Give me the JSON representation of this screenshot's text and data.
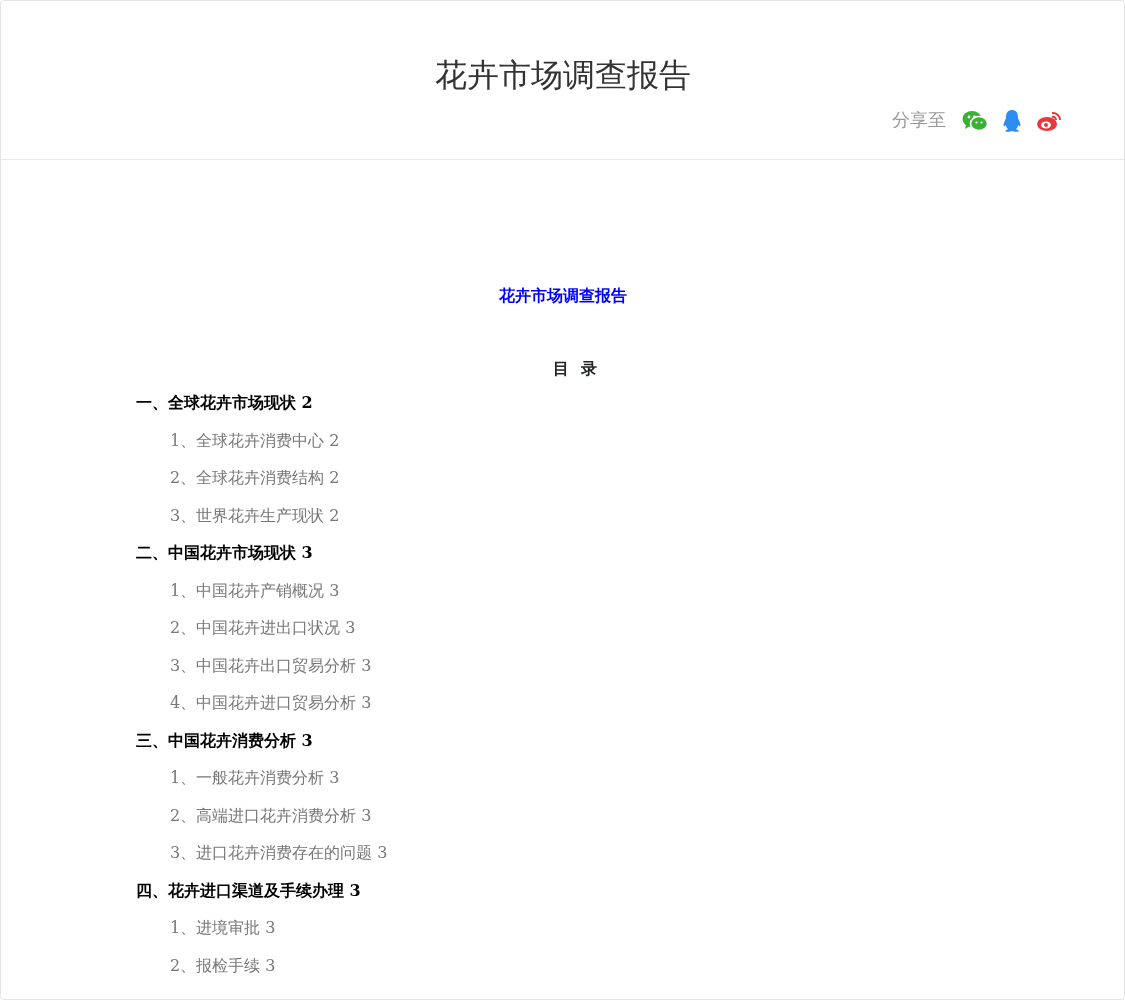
{
  "header": {
    "title": "花卉市场调查报告",
    "share_label": "分享至"
  },
  "document": {
    "title": "花卉市场调查报告",
    "toc_heading": "目  录",
    "toc": [
      {
        "text": "一、全球花卉市场现状 2",
        "children": [
          {
            "text": "1、全球花卉消费中心 2"
          },
          {
            "text": "2、全球花卉消费结构 2"
          },
          {
            "text": "3、世界花卉生产现状 2"
          }
        ]
      },
      {
        "text": "二、中国花卉市场现状 3",
        "children": [
          {
            "text": "1、中国花卉产销概况 3"
          },
          {
            "text": "2、中国花卉进出口状况 3"
          },
          {
            "text": "3、中国花卉出口贸易分析 3"
          },
          {
            "text": "4、中国花卉进口贸易分析 3"
          }
        ]
      },
      {
        "text": "三、中国花卉消费分析 3",
        "children": [
          {
            "text": "1、一般花卉消费分析 3"
          },
          {
            "text": "2、高端进口花卉消费分析 3"
          },
          {
            "text": "3、进口花卉消费存在的问题 3"
          }
        ]
      },
      {
        "text": "四、花卉进口渠道及手续办理 3",
        "children": [
          {
            "text": "1、进境审批 3"
          },
          {
            "text": "2、报检手续 3"
          }
        ]
      }
    ]
  }
}
